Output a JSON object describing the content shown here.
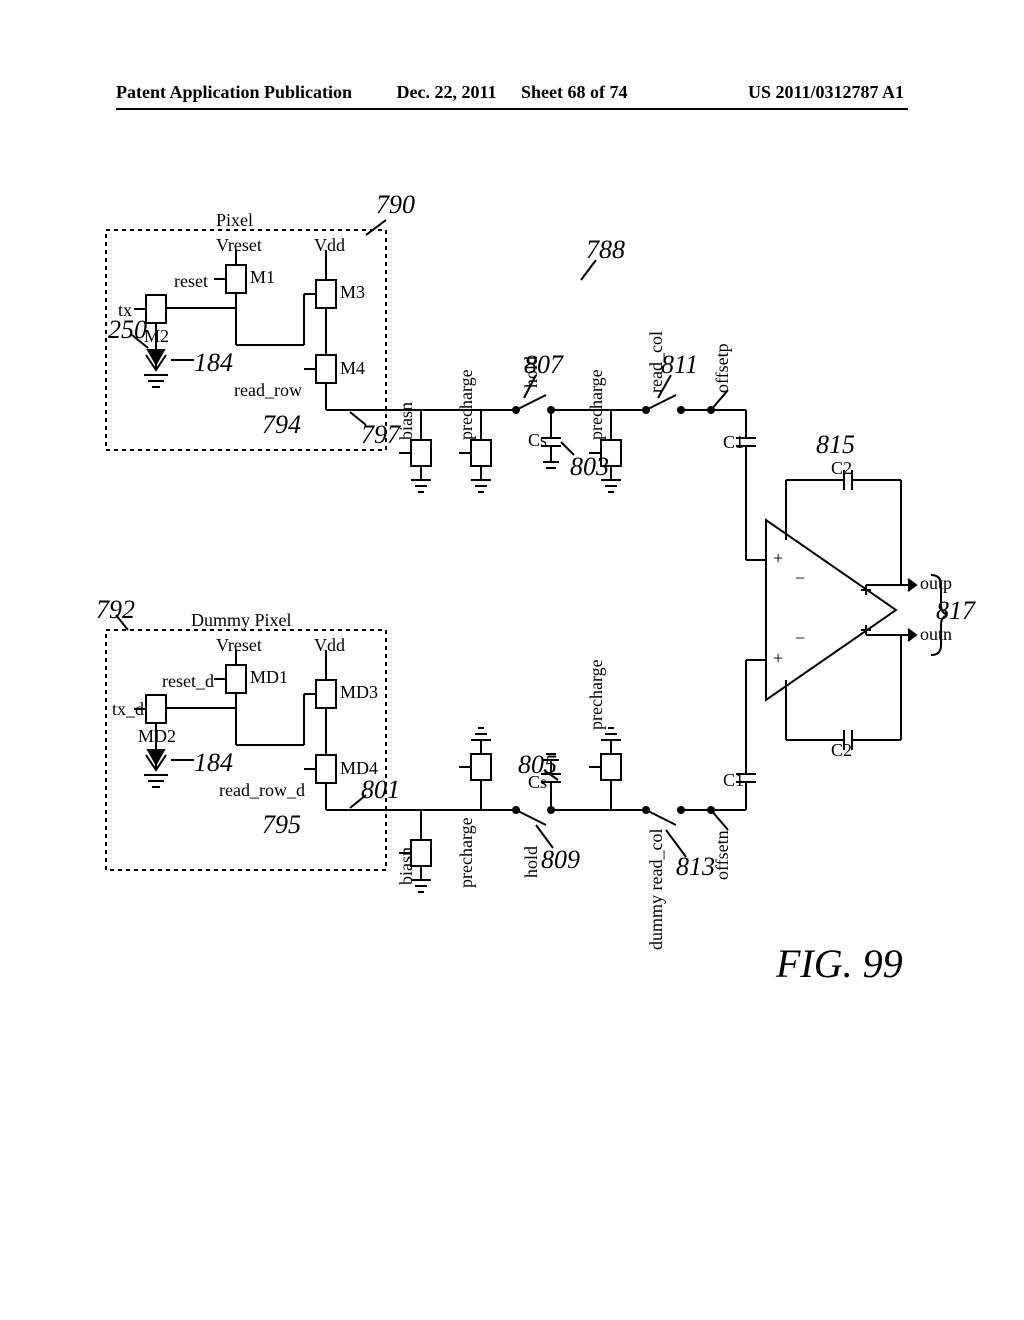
{
  "header": {
    "left": "Patent Application Publication",
    "date": "Dec. 22, 2011",
    "sheet": "Sheet 68 of 74",
    "pubno": "US 2011/0312787 A1"
  },
  "figure": {
    "number": "FIG. 99",
    "refs": {
      "r790": "790",
      "r788": "788",
      "r250": "250",
      "r184a": "184",
      "r184b": "184",
      "r797": "797",
      "r794": "794",
      "r792": "792",
      "r795": "795",
      "r801": "801",
      "r803": "803",
      "r805": "805",
      "r807": "807",
      "r809": "809",
      "r811": "811",
      "r813": "813",
      "r815": "815",
      "r817": "817"
    },
    "pixel_block": {
      "title": "Pixel",
      "M1": "M1",
      "M2": "M2",
      "M3": "M3",
      "M4": "M4",
      "tx": "tx",
      "reset": "reset",
      "Vreset": "Vreset",
      "Vdd": "Vdd",
      "read_row": "read_row"
    },
    "dummy_block": {
      "title": "Dummy Pixel",
      "MD1": "MD1",
      "MD2": "MD2",
      "MD3": "MD3",
      "MD4": "MD4",
      "tx_d": "tx_d",
      "reset_d": "reset_d",
      "Vreset": "Vreset",
      "Vdd": "Vdd",
      "read_row_d": "read_row_d"
    },
    "chain": {
      "biasn": "biasn",
      "precharge": "precharge",
      "hold": "hold",
      "Cs": "Cs",
      "read_col": "read_col",
      "dummy_read_col": "dummy read_col",
      "offsetp": "offsetp",
      "offsetn": "offsetn",
      "C1": "C1",
      "C2": "C2",
      "outp": "outp",
      "outn": "outn"
    }
  }
}
